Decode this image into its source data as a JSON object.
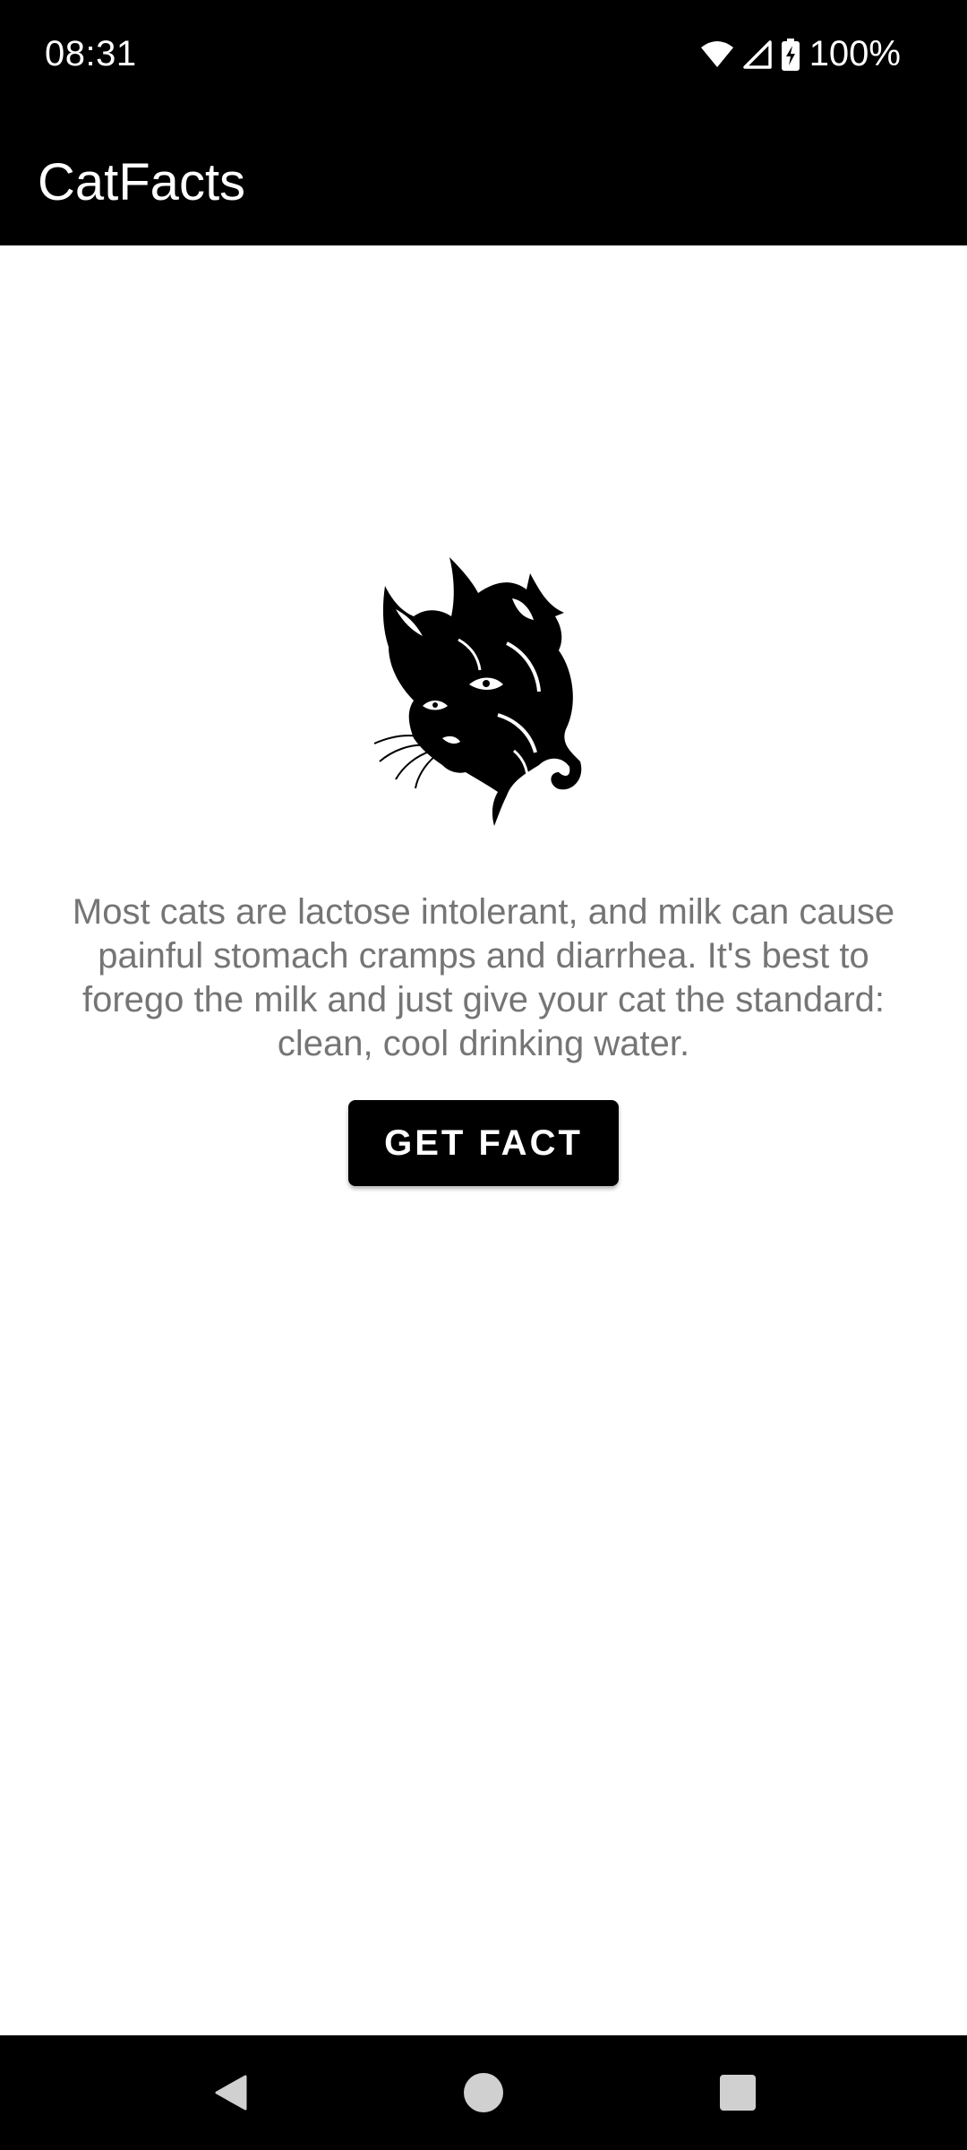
{
  "status_bar": {
    "time": "08:31",
    "battery_percent": "100%",
    "icons": [
      "wifi-icon",
      "cell-signal-icon",
      "battery-charging-icon"
    ]
  },
  "app_bar": {
    "title": "CatFacts"
  },
  "main": {
    "image_icon": "cat-head-illustration",
    "fact": "Most cats are lactose intolerant, and milk can cause painful stomach cramps and diarrhea. It's best to forego the milk and just give your cat the standard: clean, cool drinking water.",
    "button_label": "GET FACT"
  },
  "nav_bar": {
    "icons": [
      "back-icon",
      "home-icon",
      "recents-icon"
    ]
  },
  "colors": {
    "bars": "#000000",
    "background": "#ffffff",
    "fact_text": "#757575",
    "button": "#000000",
    "button_text": "#ffffff"
  }
}
